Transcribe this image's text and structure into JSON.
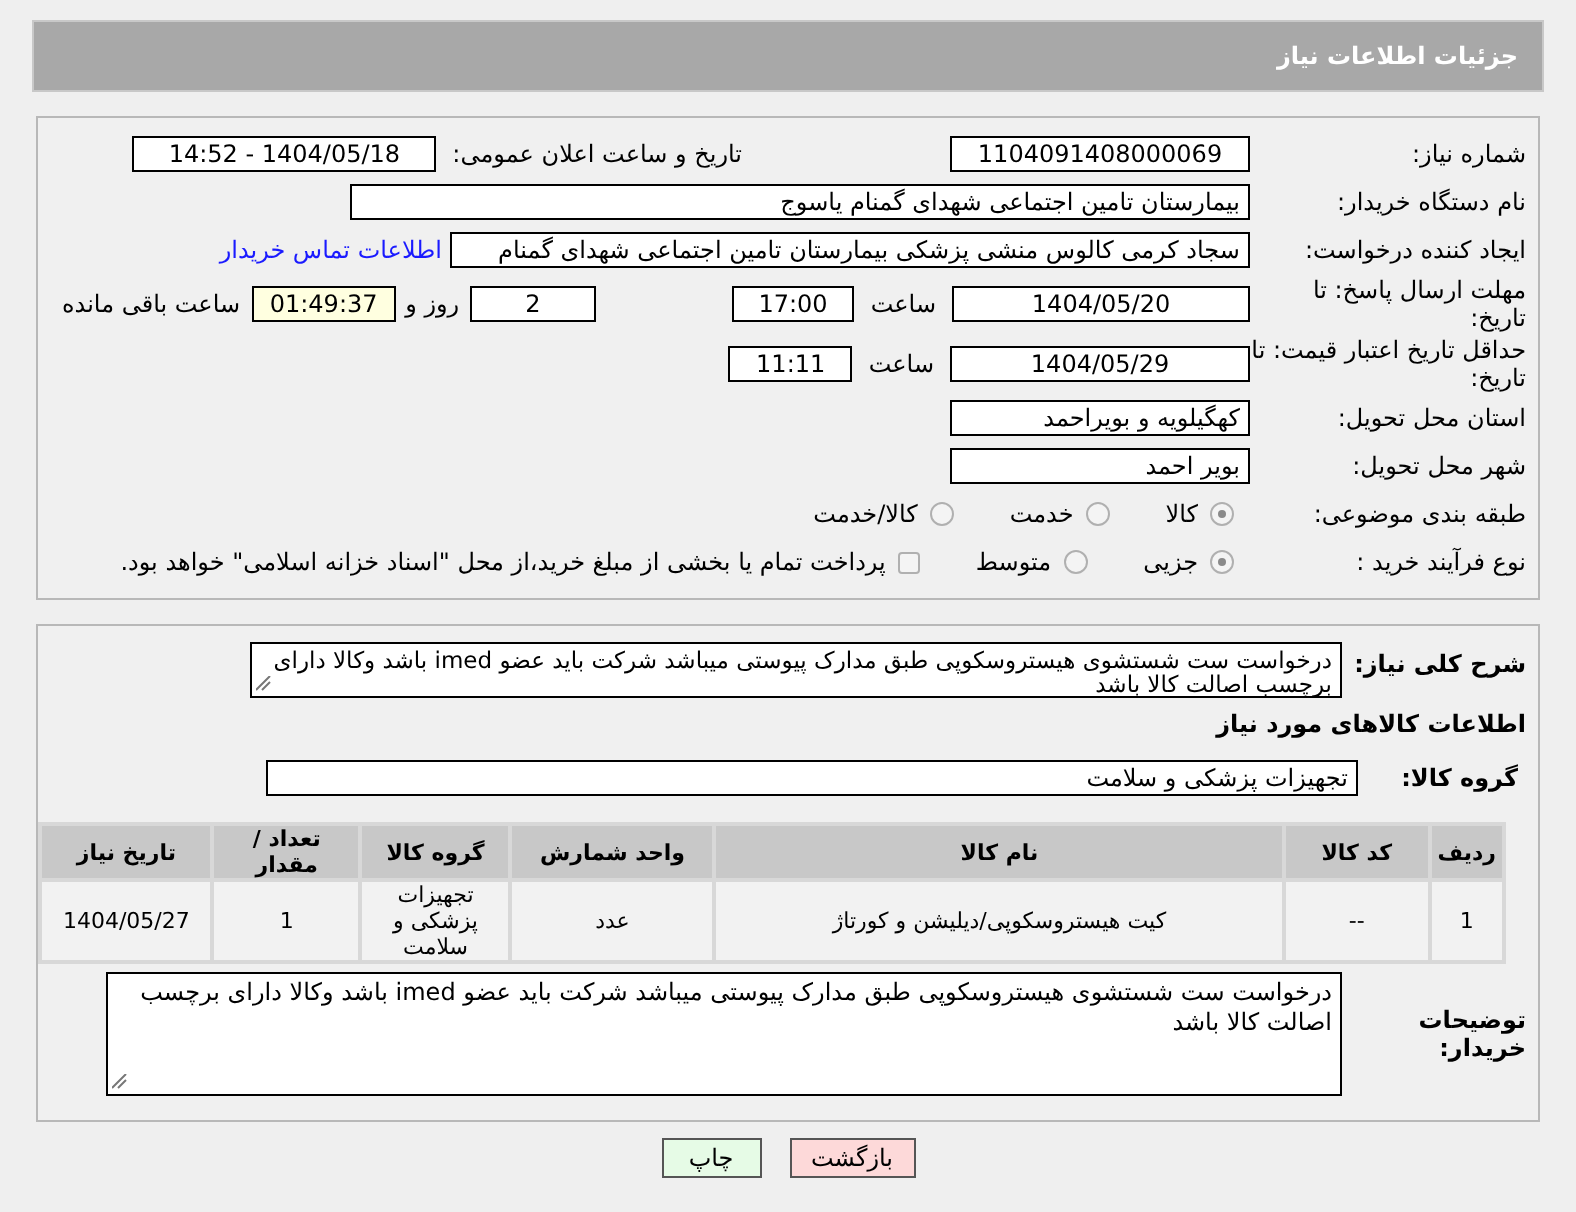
{
  "header": {
    "title": "جزئیات اطلاعات نیاز"
  },
  "need_number": {
    "label": "شماره نیاز:",
    "value": "1104091408000069"
  },
  "announce": {
    "label": "تاریخ و ساعت اعلان عمومی:",
    "value": "1404/05/18 - 14:52"
  },
  "buyer_org": {
    "label": "نام دستگاه خریدار:",
    "value": "بیمارستان تامین اجتماعی شهدای گمنام یاسوج"
  },
  "requester": {
    "label": "ایجاد کننده درخواست:",
    "value": "سجاد کرمی کالوس  منشی پزشکی  بیمارستان تامین اجتماعی شهدای گمنام",
    "link": "اطلاعات تماس خریدار"
  },
  "reply_deadline": {
    "label": "مهلت ارسال پاسخ: تا تاریخ:",
    "date": "1404/05/20",
    "time_label": "ساعت",
    "time": "17:00",
    "days": "2",
    "days_label": "روز و",
    "remaining": "01:49:37",
    "remaining_label": "ساعت باقی مانده"
  },
  "price_validity": {
    "label": "حداقل تاریخ اعتبار قیمت: تا تاریخ:",
    "date": "1404/05/29",
    "time_label": "ساعت",
    "time": "11:11"
  },
  "province": {
    "label": "استان محل تحویل:",
    "value": "کهگیلویه و بویراحمد"
  },
  "city": {
    "label": "شهر محل تحویل:",
    "value": "بویر احمد"
  },
  "category": {
    "label": "طبقه بندی موضوعی:",
    "options": [
      {
        "label": "کالا",
        "selected": true
      },
      {
        "label": "خدمت",
        "selected": false
      },
      {
        "label": "کالا/خدمت",
        "selected": false
      }
    ]
  },
  "process": {
    "label": "نوع فرآیند خرید :",
    "options": [
      {
        "label": "جزیی",
        "selected": true
      },
      {
        "label": "متوسط",
        "selected": false
      }
    ],
    "payment": {
      "label": "پرداخت تمام یا بخشی از مبلغ خرید،از محل \"اسناد خزانه اسلامی\" خواهد بود.",
      "checked": false
    }
  },
  "description": {
    "label": "شرح کلی نیاز:",
    "value": "درخواست  ست شستشوی هیستروسکوپی  طبق مدارک پیوستی میباشد شرکت باید عضو imed باشد وکالا دارای برچسب اصالت کالا باشد"
  },
  "goods_title": "اطلاعات کالاهای مورد نیاز",
  "goods_group": {
    "label": "گروه کالا:",
    "value": "تجهیزات پزشکی و سلامت"
  },
  "table": {
    "columns": [
      "ردیف",
      "کد کالا",
      "نام کالا",
      "واحد شمارش",
      "گروه کالا",
      "تعداد / مقدار",
      "تاریخ نیاز"
    ],
    "rows": [
      [
        "1",
        "--",
        "کیت هیستروسکوپی/دیلیشن و کورتاژ",
        "عدد",
        "تجهیزات پزشکی و سلامت",
        "1",
        "1404/05/27"
      ]
    ]
  },
  "buyer_notes": {
    "label": "توضیحات خریدار:",
    "value": "درخواست  ست شستشوی هیستروسکوپی  طبق مدارک پیوستی میباشد شرکت باید عضو imed باشد وکالا دارای برچسب اصالت کالا باشد"
  },
  "buttons": [
    {
      "label": "بازگشت",
      "kind": "back"
    },
    {
      "label": "چاپ",
      "kind": "print"
    }
  ]
}
